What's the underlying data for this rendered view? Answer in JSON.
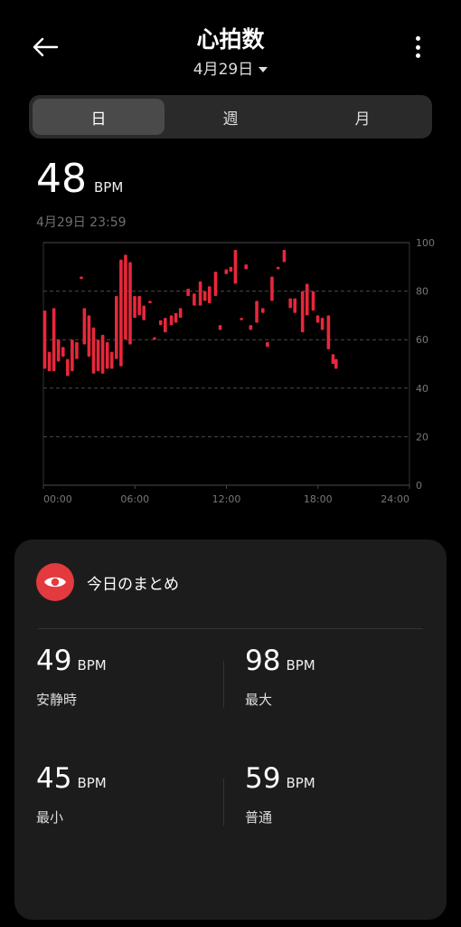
{
  "header": {
    "title": "心拍数",
    "date": "4月29日"
  },
  "tabs": [
    {
      "label": "日",
      "active": true
    },
    {
      "label": "週",
      "active": false
    },
    {
      "label": "月",
      "active": false
    }
  ],
  "current": {
    "value": "48",
    "unit": "BPM",
    "timestamp": "4月29日 23:59"
  },
  "chart_data": {
    "type": "bar",
    "description_kind": "range",
    "ylim": [
      0,
      100
    ],
    "y_ticks": [
      "0",
      "20",
      "40",
      "60",
      "80",
      "100"
    ],
    "x_ticks": [
      "00:00",
      "06:00",
      "12:00",
      "18:00",
      "24:00"
    ],
    "xlim_hours": [
      0,
      24
    ],
    "color": "#e8273a",
    "series": [
      {
        "values": [
          [
            0.1,
            48,
            72
          ],
          [
            0.4,
            47,
            55
          ],
          [
            0.7,
            47,
            73
          ],
          [
            1.0,
            51,
            60
          ],
          [
            1.3,
            53,
            57
          ],
          [
            1.6,
            45,
            52
          ],
          [
            1.9,
            47,
            60
          ],
          [
            2.2,
            52,
            59
          ],
          [
            2.5,
            85,
            86
          ],
          [
            2.7,
            58,
            73
          ],
          [
            3.0,
            53,
            70
          ],
          [
            3.3,
            46,
            65
          ],
          [
            3.6,
            47,
            60
          ],
          [
            3.9,
            46,
            62
          ],
          [
            4.2,
            48,
            59
          ],
          [
            4.5,
            48,
            55
          ],
          [
            4.8,
            52,
            78
          ],
          [
            5.1,
            49,
            93
          ],
          [
            5.4,
            60,
            95
          ],
          [
            5.7,
            58,
            92
          ],
          [
            6.0,
            69,
            78
          ],
          [
            6.3,
            70,
            78
          ],
          [
            6.6,
            68,
            74
          ],
          [
            7.0,
            75,
            76
          ],
          [
            7.3,
            60,
            61
          ],
          [
            7.7,
            66,
            68
          ],
          [
            8.0,
            63,
            69
          ],
          [
            8.4,
            66,
            70
          ],
          [
            8.7,
            67,
            71
          ],
          [
            9.0,
            69,
            73
          ],
          [
            9.5,
            78,
            81
          ],
          [
            9.9,
            74,
            79
          ],
          [
            10.3,
            74,
            84
          ],
          [
            10.6,
            76,
            80
          ],
          [
            10.9,
            75,
            82
          ],
          [
            11.3,
            78,
            88
          ],
          [
            11.6,
            64,
            66
          ],
          [
            12.0,
            87,
            89
          ],
          [
            12.3,
            88,
            90
          ],
          [
            12.6,
            83,
            97
          ],
          [
            13.0,
            68,
            69
          ],
          [
            13.3,
            89,
            91
          ],
          [
            13.6,
            64,
            66
          ],
          [
            14.0,
            67,
            76
          ],
          [
            14.4,
            71,
            73
          ],
          [
            14.7,
            57,
            59
          ],
          [
            15.0,
            76,
            86
          ],
          [
            15.4,
            89,
            90
          ],
          [
            15.8,
            92,
            97
          ],
          [
            16.2,
            73,
            77
          ],
          [
            16.5,
            71,
            77
          ],
          [
            17.0,
            63,
            80
          ],
          [
            17.3,
            70,
            83
          ],
          [
            17.7,
            72,
            80
          ],
          [
            18.0,
            67,
            70
          ],
          [
            18.3,
            64,
            69
          ],
          [
            18.7,
            56,
            70
          ],
          [
            19.0,
            50,
            54
          ],
          [
            19.2,
            48,
            52
          ]
        ]
      }
    ]
  },
  "summary": {
    "title": "今日のまとめ",
    "icon": "eye-icon",
    "stats": [
      {
        "value": "49",
        "unit": "BPM",
        "label": "安静時"
      },
      {
        "value": "98",
        "unit": "BPM",
        "label": "最大"
      },
      {
        "value": "45",
        "unit": "BPM",
        "label": "最小"
      },
      {
        "value": "59",
        "unit": "BPM",
        "label": "普通"
      }
    ]
  },
  "colors": {
    "accent": "#e23a3e",
    "background": "#000000",
    "card": "#1c1c1c"
  }
}
